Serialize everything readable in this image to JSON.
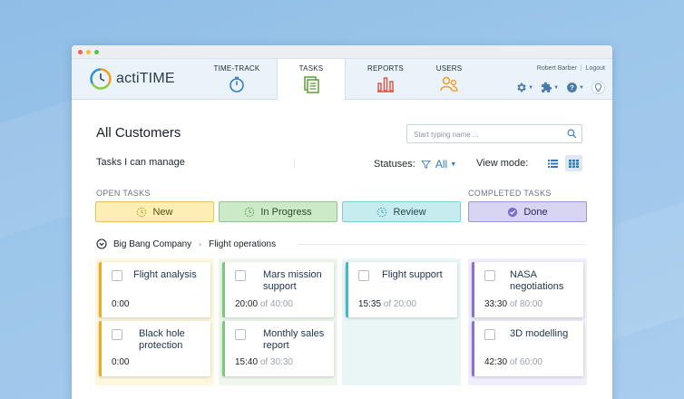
{
  "app": {
    "name": "actiTIME"
  },
  "nav": [
    {
      "label": "TIME-TRACK",
      "icon": "stopwatch-icon"
    },
    {
      "label": "TASKS",
      "icon": "tasks-icon",
      "active": true
    },
    {
      "label": "REPORTS",
      "icon": "bar-chart-icon"
    },
    {
      "label": "USERS",
      "icon": "users-icon"
    }
  ],
  "user": {
    "name": "Robert Barber",
    "logout": "Logout"
  },
  "header_icons": [
    "gear-icon",
    "puzzle-icon",
    "help-icon",
    "lightbulb-icon"
  ],
  "page": {
    "title": "All Customers",
    "search_placeholder": "Start typing name ..."
  },
  "toolbar": {
    "filter": "Tasks I can manage",
    "statuses_label": "Statuses:",
    "statuses_value": "All",
    "viewmode_label": "View mode:"
  },
  "sections": {
    "open": "OPEN TASKS",
    "completed": "COMPLETED TASKS"
  },
  "columns": [
    {
      "label": "New",
      "bg": "#fdeeb4",
      "border": "#e4c35f",
      "text": "#5a4a10"
    },
    {
      "label": "In Progress",
      "bg": "#cdeac8",
      "border": "#8fc888",
      "text": "#2c4a27"
    },
    {
      "label": "Review",
      "bg": "#c6ecf0",
      "border": "#7ccfd8",
      "text": "#1f4a50"
    },
    {
      "label": "Done",
      "bg": "#d7d5f2",
      "border": "#9d97d6",
      "text": "#2a2760"
    }
  ],
  "breadcrumb": {
    "customer": "Big Bang Company",
    "project": "Flight operations"
  },
  "cards": {
    "new": [
      {
        "name": "Flight analysis",
        "time": "0:00",
        "of": ""
      },
      {
        "name": "Black hole protection",
        "time": "0:00",
        "of": ""
      }
    ],
    "progress": [
      {
        "name": "Mars mission support",
        "time": "20:00",
        "of": "of 40:00"
      },
      {
        "name": "Monthly sales report",
        "time": "15:40",
        "of": "of 30:30"
      }
    ],
    "review": [
      {
        "name": "Flight support",
        "time": "15:35",
        "of": "of 20:00"
      }
    ],
    "done": [
      {
        "name": "NASA negotiations",
        "time": "33:30",
        "of": "of 80:00"
      },
      {
        "name": "3D modelling",
        "time": "42:30",
        "of": "of 60:00"
      }
    ]
  },
  "colors": {
    "accent": "#2f79c4",
    "new": "#e7ad1f",
    "progress": "#7cc97c",
    "review": "#3dbcc6",
    "done": "#8a72d0"
  }
}
